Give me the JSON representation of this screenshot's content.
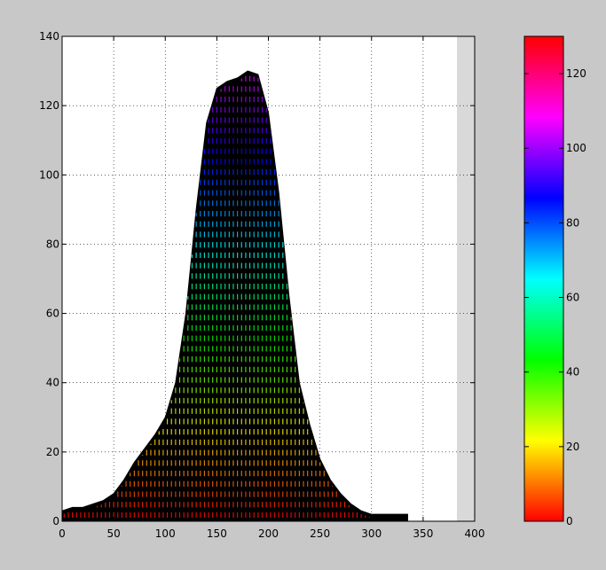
{
  "chart_data": {
    "type": "area",
    "title": "",
    "xlabel": "",
    "ylabel": "",
    "xlim": [
      0,
      400
    ],
    "ylim": [
      0,
      140
    ],
    "x_ticks": [
      "0",
      "50",
      "100",
      "150",
      "200",
      "250",
      "300",
      "350",
      "400"
    ],
    "y_ticks": [
      "0",
      "20",
      "40",
      "60",
      "80",
      "100",
      "120",
      "140"
    ],
    "grid": true,
    "colormap": "hsv",
    "colorbar": {
      "range": [
        0,
        130
      ],
      "ticks": [
        "0",
        "20",
        "40",
        "60",
        "80",
        "100",
        "120"
      ],
      "position": "right"
    },
    "series": [
      {
        "x": [
          0,
          10,
          20,
          30,
          40,
          50,
          60,
          70,
          80,
          90,
          100,
          110,
          120,
          130,
          140,
          150,
          160,
          170,
          180,
          190,
          200,
          210,
          220,
          230,
          240,
          250,
          260,
          270,
          280,
          290,
          300,
          310,
          320,
          330,
          335
        ],
        "values": [
          3,
          4,
          4,
          5,
          6,
          8,
          12,
          17,
          21,
          25,
          30,
          40,
          60,
          90,
          115,
          125,
          127,
          128,
          130,
          129,
          118,
          95,
          65,
          40,
          28,
          18,
          12,
          8,
          5,
          3,
          2,
          2,
          2,
          2,
          2
        ]
      }
    ],
    "colors": {
      "background": "#c8c8c8",
      "plot_area": "#ffffff",
      "fill": "#000000",
      "grid": "#000000"
    }
  }
}
